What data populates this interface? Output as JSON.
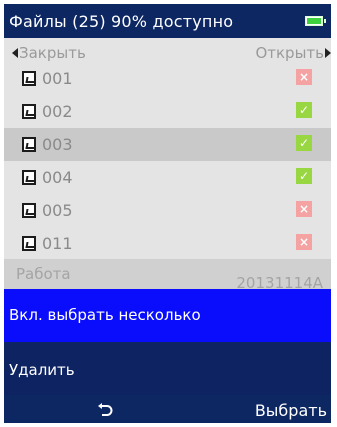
{
  "header": {
    "title": "Файлы (25) 90% доступно",
    "battery_icon": "battery-icon"
  },
  "nav": {
    "close_label": "Закрыть",
    "open_label": "Открыть"
  },
  "files": [
    {
      "name": "001",
      "status": "no"
    },
    {
      "name": "002",
      "status": "ok"
    },
    {
      "name": "003",
      "status": "ok",
      "selected": true
    },
    {
      "name": "004",
      "status": "ok"
    },
    {
      "name": "005",
      "status": "no"
    },
    {
      "name": "011",
      "status": "no"
    }
  ],
  "work": {
    "label": "Работа",
    "value": "20131114A"
  },
  "menu": {
    "multi_select_label": "Вкл. выбрать несколько",
    "delete_label": "Удалить"
  },
  "softkeys": {
    "back_icon": "back-arrow-icon",
    "select_label": "Выбрать"
  },
  "colors": {
    "title_bg": "#0d2763",
    "highlight_blue": "#0a0dfc",
    "ok_green": "#98d742",
    "no_red": "#f4a2a2"
  }
}
